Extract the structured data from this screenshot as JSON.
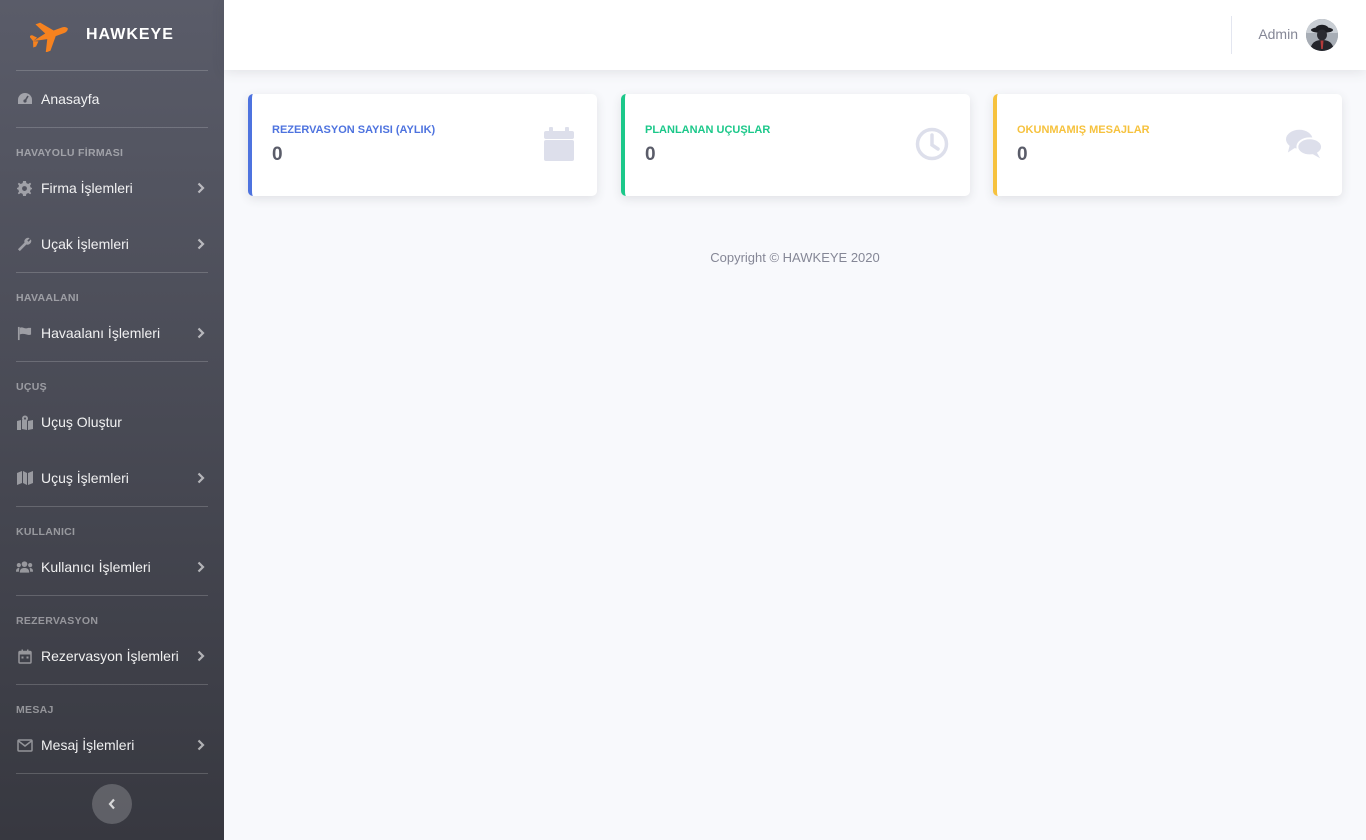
{
  "brand": {
    "name": "HAWKEYE",
    "icon": "plane-icon",
    "icon_color": "#f6821f"
  },
  "sidebar": {
    "dashboard": {
      "label": "Anasayfa",
      "icon": "tachometer-icon"
    },
    "sections": [
      {
        "heading": "HAVAYOLU FİRMASI",
        "items": [
          {
            "label": "Firma İşlemleri",
            "icon": "gear-icon"
          },
          {
            "label": "Uçak İşlemleri",
            "icon": "wrench-icon"
          }
        ]
      },
      {
        "heading": "HAVAALANI",
        "items": [
          {
            "label": "Havaalanı İşlemleri",
            "icon": "flag-icon"
          }
        ]
      },
      {
        "heading": "UÇUŞ",
        "items": [
          {
            "label": "Uçuş Oluştur",
            "icon": "map-marked-icon"
          },
          {
            "label": "Uçuş İşlemleri",
            "icon": "map-icon"
          }
        ]
      },
      {
        "heading": "KULLANICI",
        "items": [
          {
            "label": "Kullanıcı İşlemleri",
            "icon": "users-icon"
          }
        ]
      },
      {
        "heading": "REZERVASYON",
        "items": [
          {
            "label": "Rezervasyon İşlemleri",
            "icon": "calendar-icon"
          }
        ]
      },
      {
        "heading": "MESAJ",
        "items": [
          {
            "label": "Mesaj İşlemleri",
            "icon": "envelope-icon"
          }
        ]
      }
    ]
  },
  "topbar": {
    "user_name": "Admin"
  },
  "cards": [
    {
      "title": "REZERVASYON SAYISI (AYLIK)",
      "value": "0",
      "color": "#4e73df",
      "icon": "calendar-icon"
    },
    {
      "title": "PLANLANAN UÇUŞLAR",
      "value": "0",
      "color": "#1cc88a",
      "icon": "clock-icon"
    },
    {
      "title": "OKUNMAMIŞ MESAJLAR",
      "value": "0",
      "color": "#f6c23e",
      "icon": "comments-icon"
    }
  ],
  "footer": {
    "text": "Copyright © HAWKEYE 2020"
  }
}
